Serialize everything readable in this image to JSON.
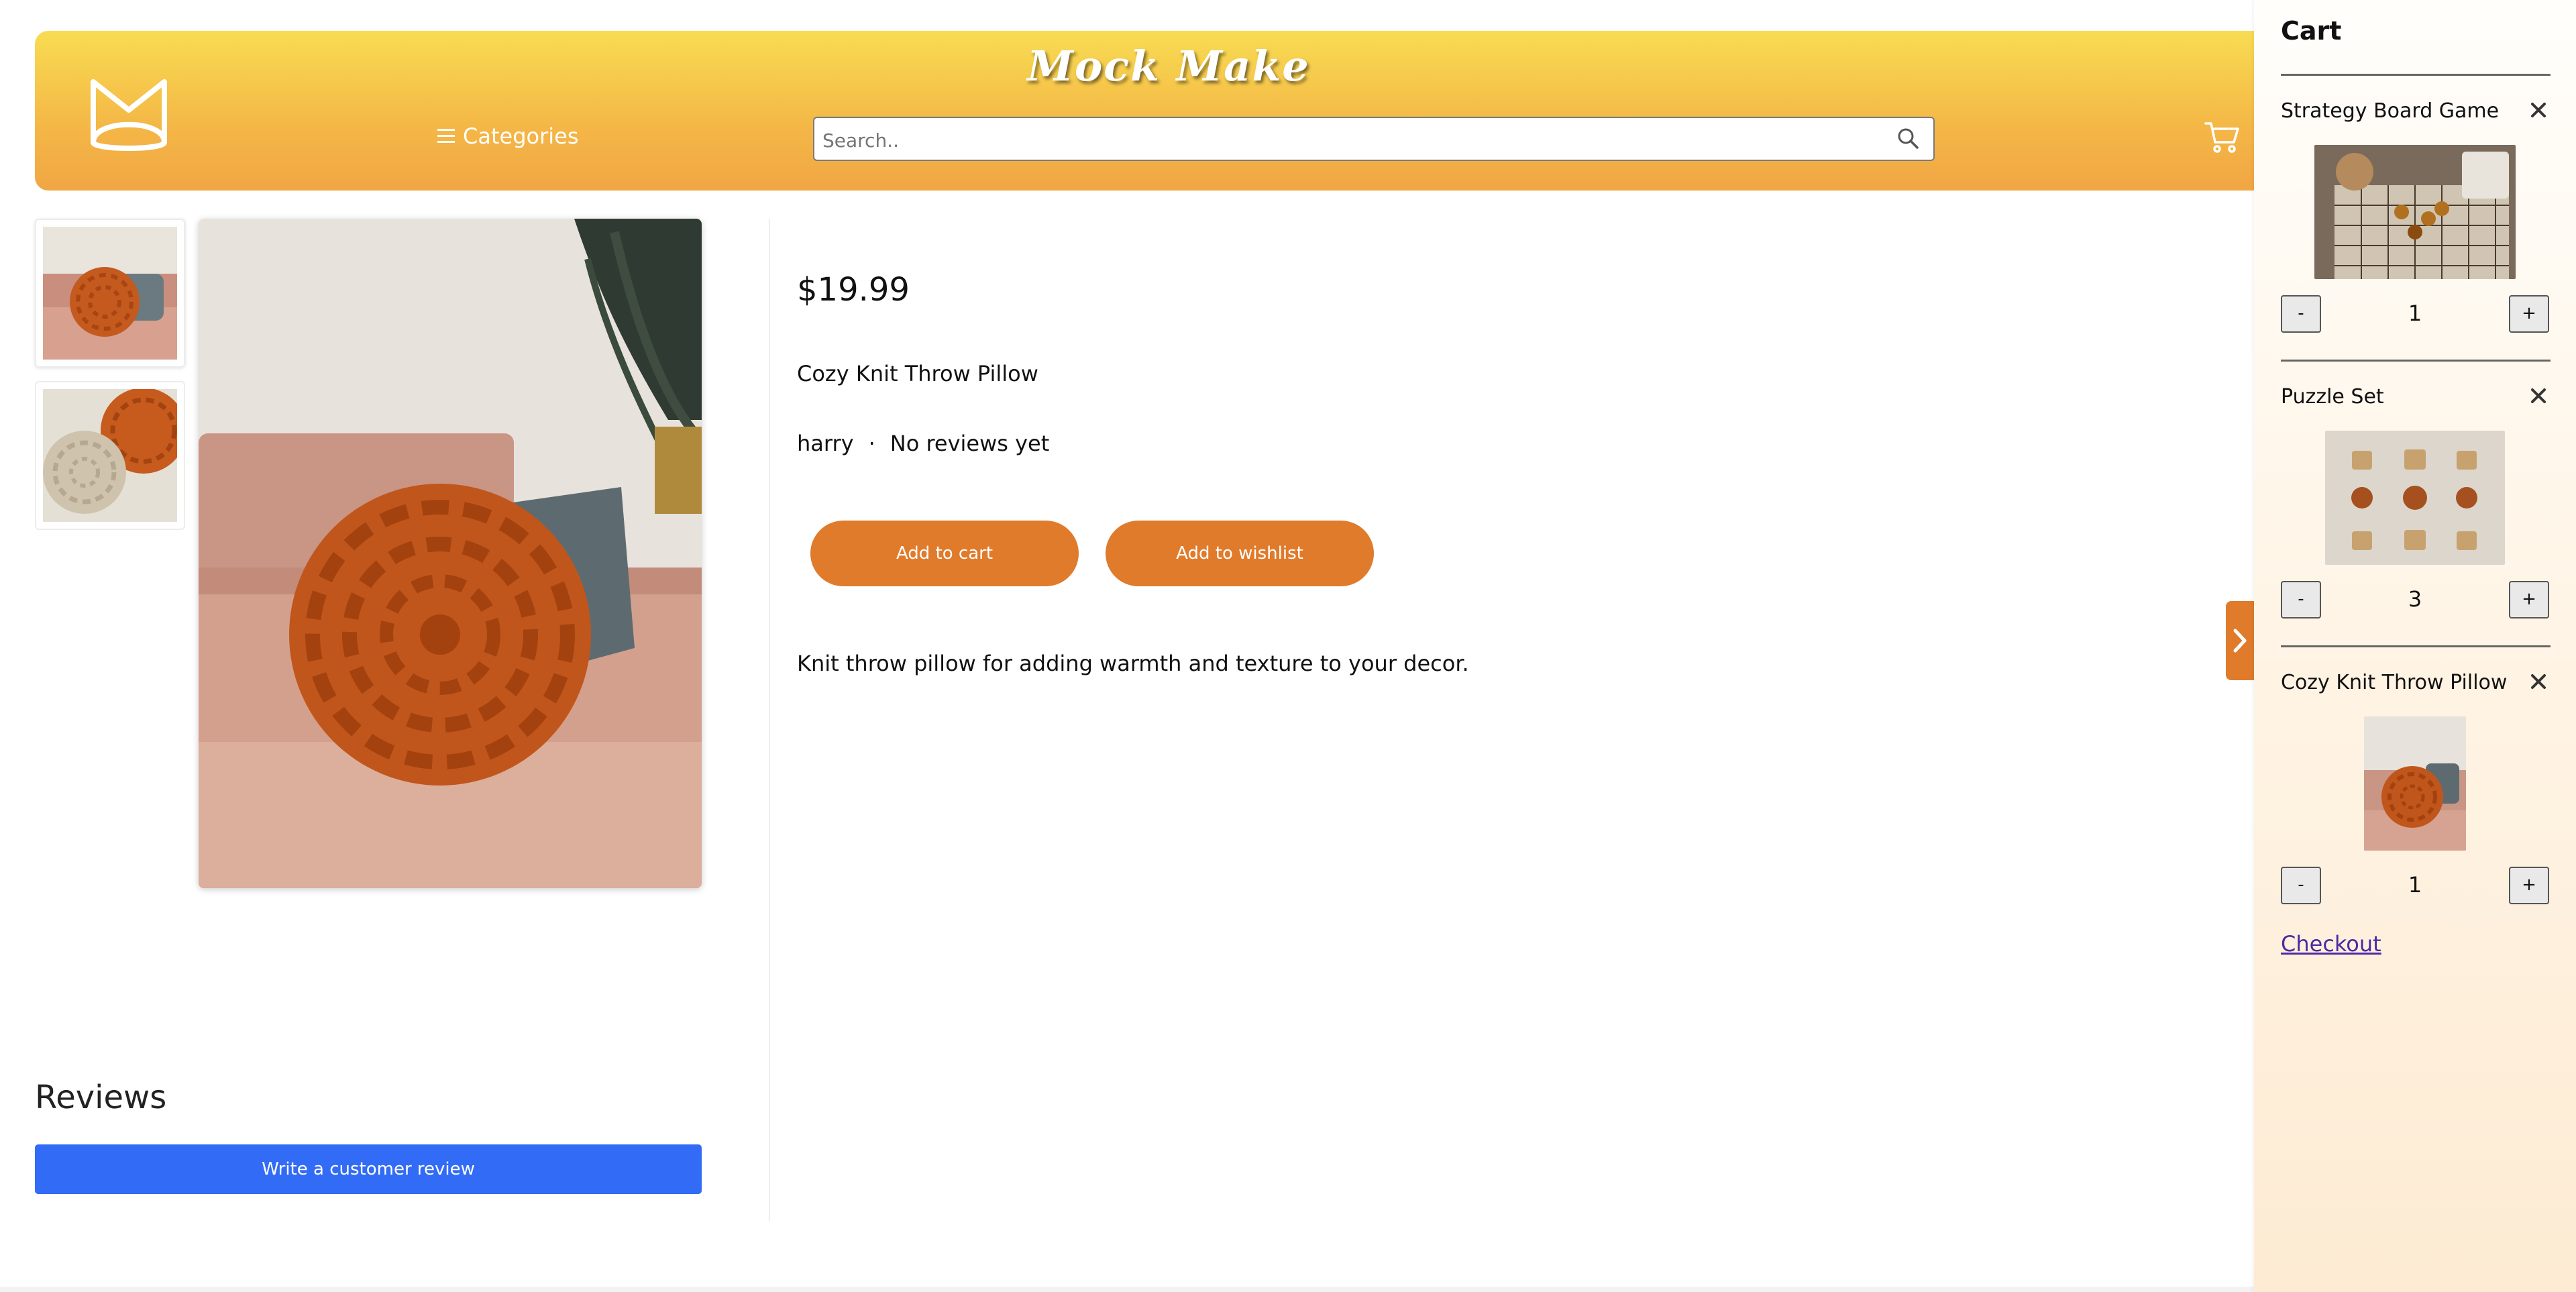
{
  "header": {
    "brand": "Mock Make",
    "categories_label": "Categories",
    "search_placeholder": "Search.."
  },
  "product": {
    "price": "$19.99",
    "name": "Cozy Knit Throw Pillow",
    "seller": "harry",
    "separator": "·",
    "review_status": "No reviews yet",
    "add_to_cart": "Add to cart",
    "add_to_wishlist": "Add to wishlist",
    "description": "Knit throw pillow for adding warmth and texture to your decor."
  },
  "reviews": {
    "heading": "Reviews",
    "write_button": "Write a customer review"
  },
  "cart": {
    "title": "Cart",
    "items": [
      {
        "name": "Strategy Board Game",
        "qty": "1"
      },
      {
        "name": "Puzzle Set",
        "qty": "3"
      },
      {
        "name": "Cozy Knit Throw Pillow",
        "qty": "1"
      }
    ],
    "minus": "-",
    "plus": "+",
    "checkout": "Checkout"
  },
  "colors": {
    "accent_orange": "#e07b2b",
    "header_top": "#f8dc52",
    "header_bottom": "#f1a644",
    "review_button": "#316bf6"
  },
  "icons": [
    "logo-icon",
    "menu-icon",
    "search-icon",
    "cart-icon",
    "chevron-right-icon",
    "close-icon"
  ]
}
